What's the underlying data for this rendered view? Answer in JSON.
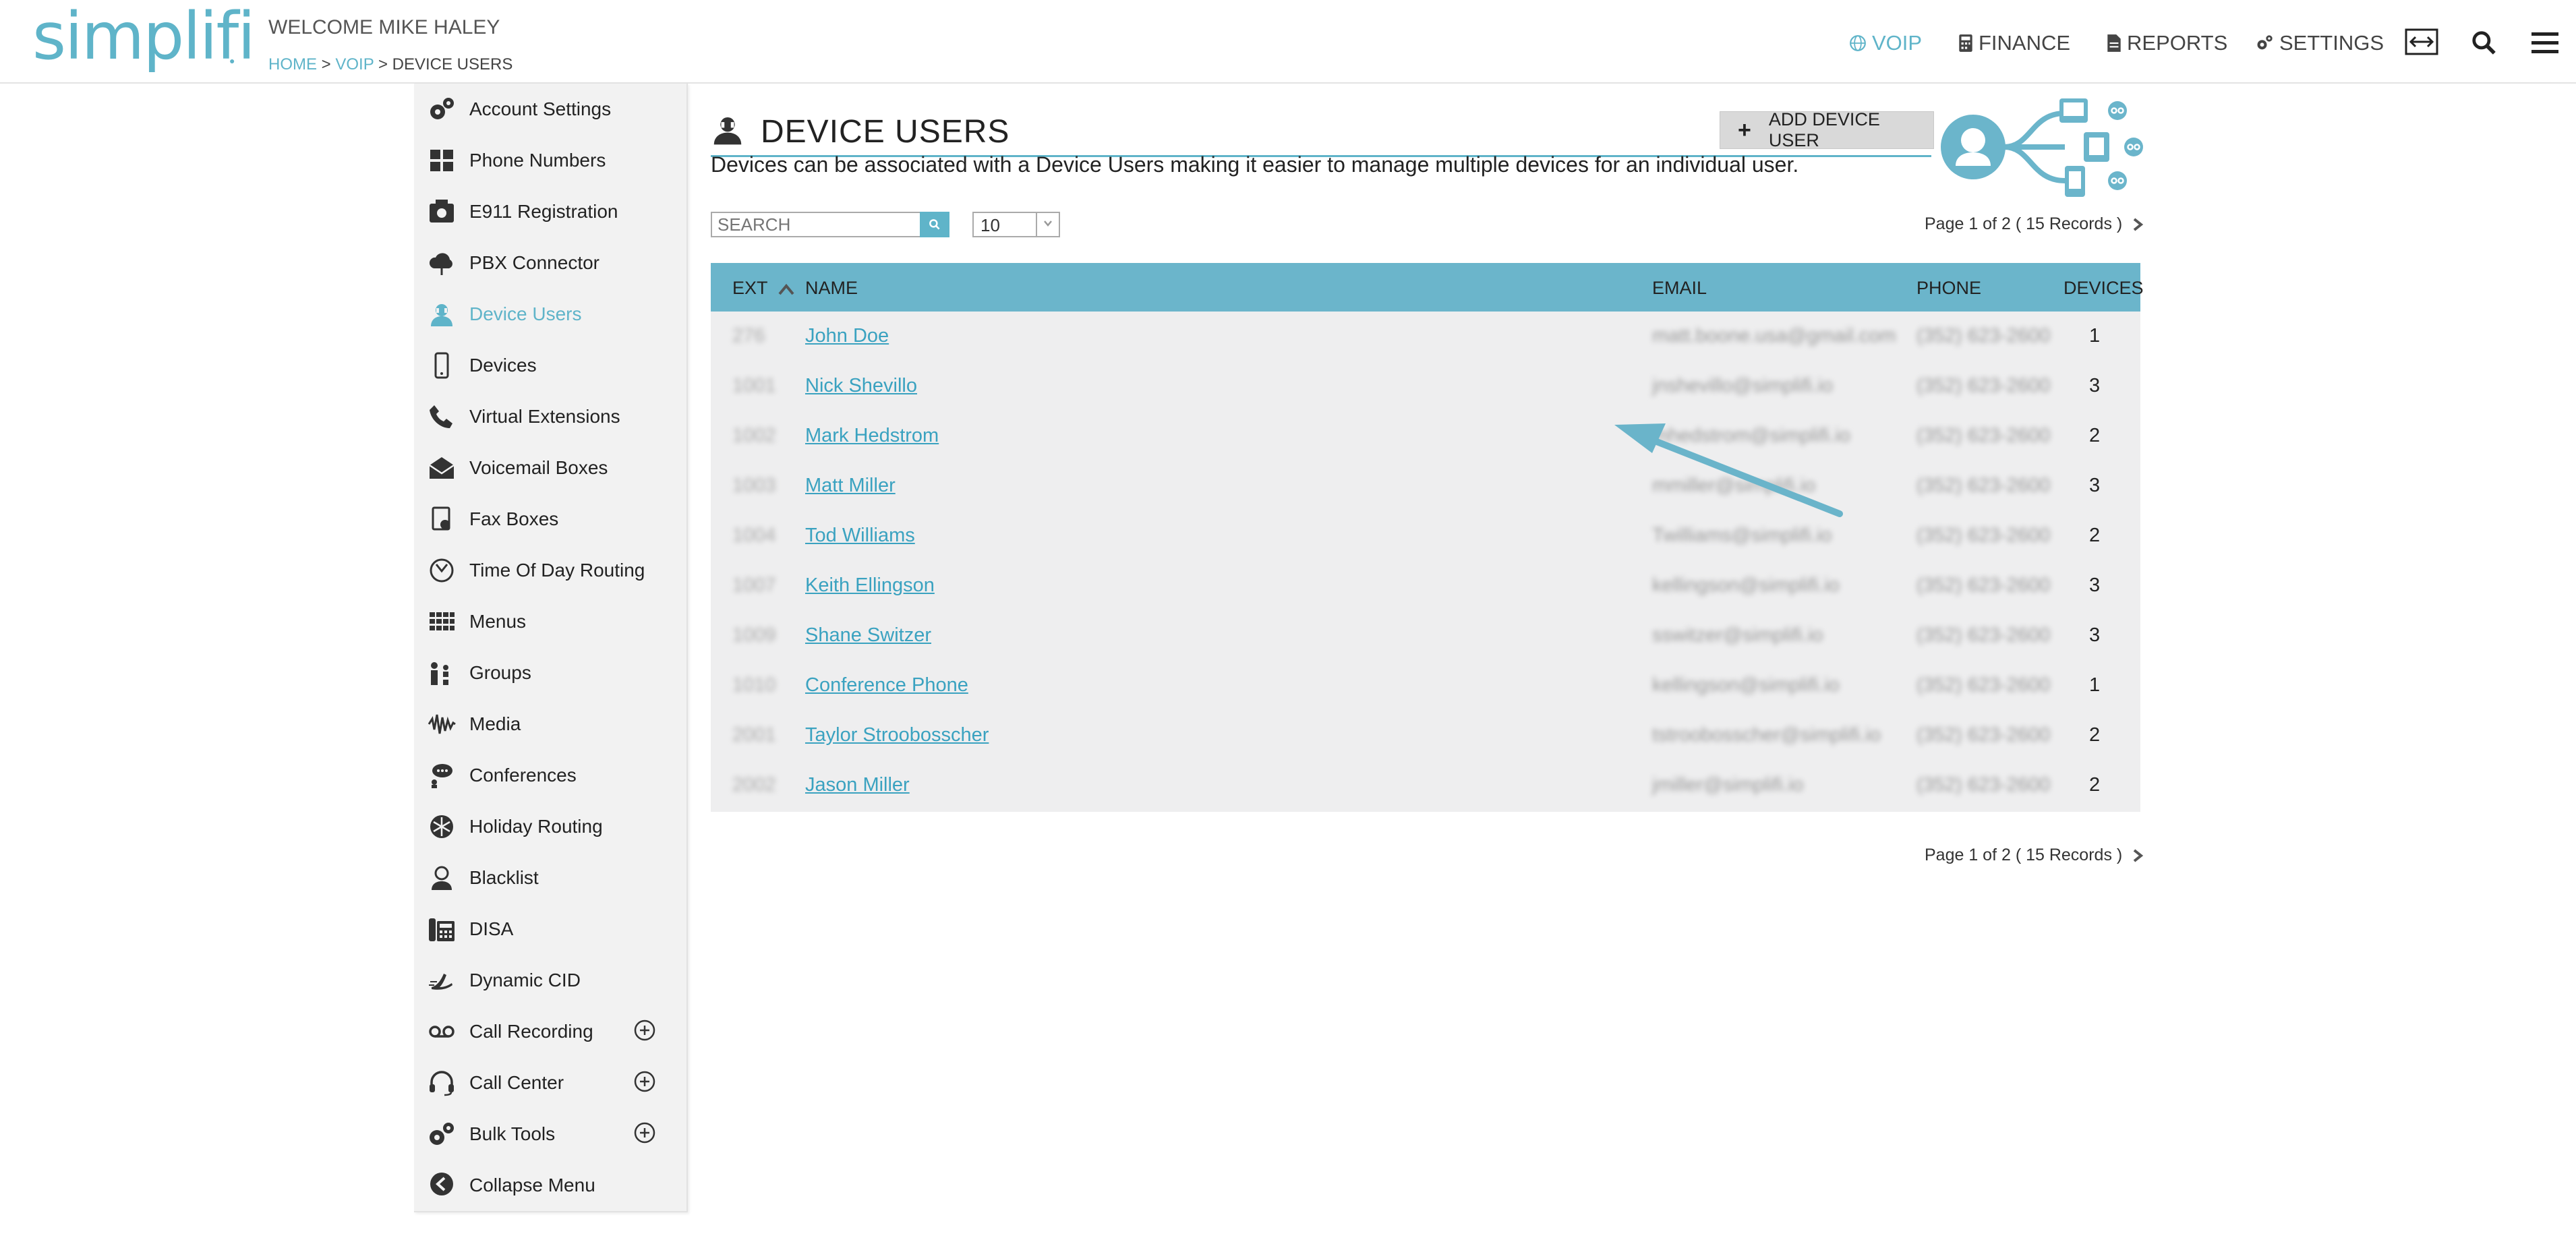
{
  "header": {
    "logo": "simplifi",
    "welcome": "WELCOME MIKE HALEY",
    "breadcrumb": {
      "home": "HOME",
      "sep1": " > ",
      "voip": "VOIP",
      "sep2": " > ",
      "current": "DEVICE USERS"
    },
    "nav": {
      "voip": "VOIP",
      "finance": "FINANCE",
      "reports": "REPORTS",
      "settings": "SETTINGS"
    }
  },
  "sidebar": {
    "items": [
      {
        "label": "Account Settings",
        "icon": "gears-icon"
      },
      {
        "label": "Phone Numbers",
        "icon": "keypad-icon"
      },
      {
        "label": "E911 Registration",
        "icon": "emergency-phone-icon"
      },
      {
        "label": "PBX Connector",
        "icon": "cloud-connector-icon"
      },
      {
        "label": "Device Users",
        "icon": "device-user-icon",
        "active": true
      },
      {
        "label": "Devices",
        "icon": "mobile-device-icon"
      },
      {
        "label": "Virtual Extensions",
        "icon": "handset-icon"
      },
      {
        "label": "Voicemail Boxes",
        "icon": "envelope-icon"
      },
      {
        "label": "Fax Boxes",
        "icon": "fax-icon"
      },
      {
        "label": "Time Of Day Routing",
        "icon": "clock-icon"
      },
      {
        "label": "Menus",
        "icon": "grid-menu-icon"
      },
      {
        "label": "Groups",
        "icon": "group-icon"
      },
      {
        "label": "Media",
        "icon": "waveform-icon"
      },
      {
        "label": "Conferences",
        "icon": "conference-icon"
      },
      {
        "label": "Holiday Routing",
        "icon": "snowflake-icon"
      },
      {
        "label": "Blacklist",
        "icon": "blocked-user-icon"
      },
      {
        "label": "DISA",
        "icon": "desk-phone-icon"
      },
      {
        "label": "Dynamic CID",
        "icon": "dynamic-cid-icon"
      },
      {
        "label": "Call Recording",
        "icon": "voicemail-tape-icon",
        "expandable": true
      },
      {
        "label": "Call Center",
        "icon": "headset-icon",
        "expandable": true
      },
      {
        "label": "Bulk Tools",
        "icon": "bulk-gears-icon",
        "expandable": true
      },
      {
        "label": "Collapse Menu",
        "icon": "collapse-arrow-icon"
      }
    ]
  },
  "main": {
    "title": "DEVICE USERS",
    "add_button": "ADD DEVICE USER",
    "add_button_plus": "+",
    "description": "Devices can be associated with a Device Users making it easier to manage multiple devices for an individual user.",
    "search_placeholder": "SEARCH",
    "page_size": "10",
    "pager_text": "Page 1 of 2 ( 15 Records )"
  },
  "table": {
    "columns": {
      "ext": "EXT",
      "name": "NAME",
      "email": "EMAIL",
      "phone": "PHONE",
      "devices": "DEVICES"
    },
    "rows": [
      {
        "ext": "276",
        "name": "John Doe",
        "email": "matt.boone.usa@gmail.com",
        "phone": "(352) 623-2600",
        "devices": "1"
      },
      {
        "ext": "1001",
        "name": "Nick Shevillo",
        "email": "jnshevillo@simplifi.io",
        "phone": "(352) 623-2600",
        "devices": "3"
      },
      {
        "ext": "1002",
        "name": "Mark Hedstrom",
        "email": "mhedstrom@simplifi.io",
        "phone": "(352) 623-2600",
        "devices": "2"
      },
      {
        "ext": "1003",
        "name": "Matt Miller",
        "email": "mmiller@simplifi.io",
        "phone": "(352) 623-2600",
        "devices": "3"
      },
      {
        "ext": "1004",
        "name": "Tod Williams",
        "email": "Twilliams@simplifi.io",
        "phone": "(352) 623-2600",
        "devices": "2"
      },
      {
        "ext": "1007",
        "name": "Keith Ellingson",
        "email": "kellingson@simplifi.io",
        "phone": "(352) 623-2600",
        "devices": "3"
      },
      {
        "ext": "1009",
        "name": "Shane Switzer",
        "email": "sswitzer@simplifi.io",
        "phone": "(352) 623-2600",
        "devices": "3"
      },
      {
        "ext": "1010",
        "name": "Conference Phone",
        "email": "kellingson@simplifi.io",
        "phone": "(352) 623-2600",
        "devices": "1"
      },
      {
        "ext": "2001",
        "name": "Taylor Stroobosscher",
        "email": "tstroobosscher@simplifi.io",
        "phone": "(352) 623-2600",
        "devices": "2"
      },
      {
        "ext": "2002",
        "name": "Jason Miller",
        "email": "jmiller@simplifi.io",
        "phone": "(352) 623-2600",
        "devices": "2"
      }
    ]
  },
  "colors": {
    "accent": "#5fb4c9",
    "table_header": "#6bb5cb",
    "row_bg": "#eeeeef",
    "arrow": "#6ab4ca"
  }
}
